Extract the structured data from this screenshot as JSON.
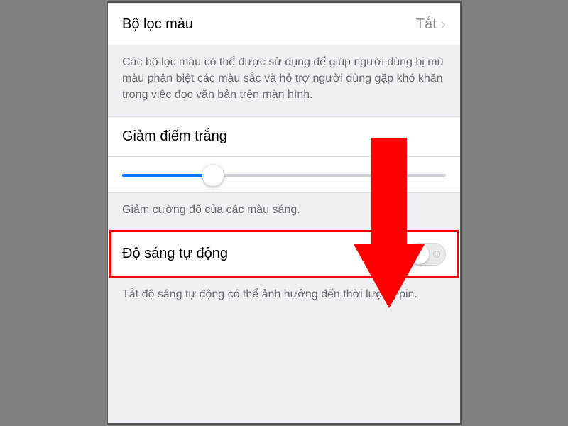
{
  "rows": {
    "color_filter": {
      "label": "Bộ lọc màu",
      "value": "Tắt"
    },
    "color_filter_footer": "Các bộ lọc màu có thể được sử dụng để giúp người dùng bị mù màu phân biệt các màu sắc và hỗ trợ người dùng gặp khó khăn trong việc đọc văn bản trên màn hình.",
    "reduce_white": {
      "label": "Giảm điểm trắng"
    },
    "reduce_white_footer": "Giảm cường độ của các màu sáng.",
    "auto_brightness": {
      "label": "Độ sáng tự động",
      "enabled": false
    },
    "auto_brightness_footer": "Tắt độ sáng tự động có thể ảnh hưởng đến thời lượng pin."
  },
  "slider": {
    "value_percent": 28
  },
  "colors": {
    "accent": "#007aff",
    "annotation": "#ff0000"
  }
}
